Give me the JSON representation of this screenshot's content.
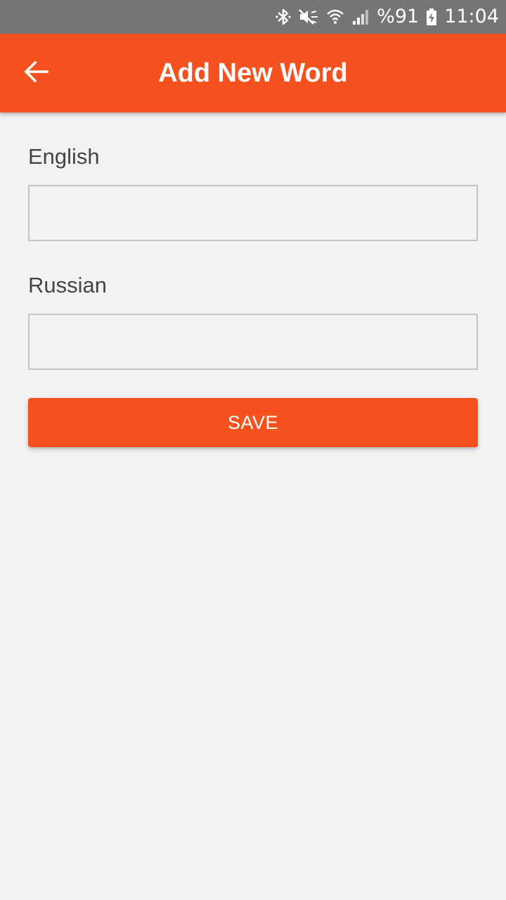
{
  "status_bar": {
    "icons": [
      "bluetooth-icon",
      "mute-icon",
      "wifi-icon",
      "signal-icon",
      "battery-charging-icon"
    ],
    "battery": "%91",
    "time": "11:04"
  },
  "app_bar": {
    "title": "Add New Word",
    "back_icon": "arrow-left-icon",
    "color": "#f5511e"
  },
  "form": {
    "english": {
      "label": "English",
      "value": "",
      "placeholder": ""
    },
    "russian": {
      "label": "Russian",
      "value": "",
      "placeholder": ""
    },
    "save_label": "SAVE"
  },
  "colors": {
    "accent": "#f5511e",
    "background": "#f2f2f2",
    "status_bar": "#757575"
  }
}
